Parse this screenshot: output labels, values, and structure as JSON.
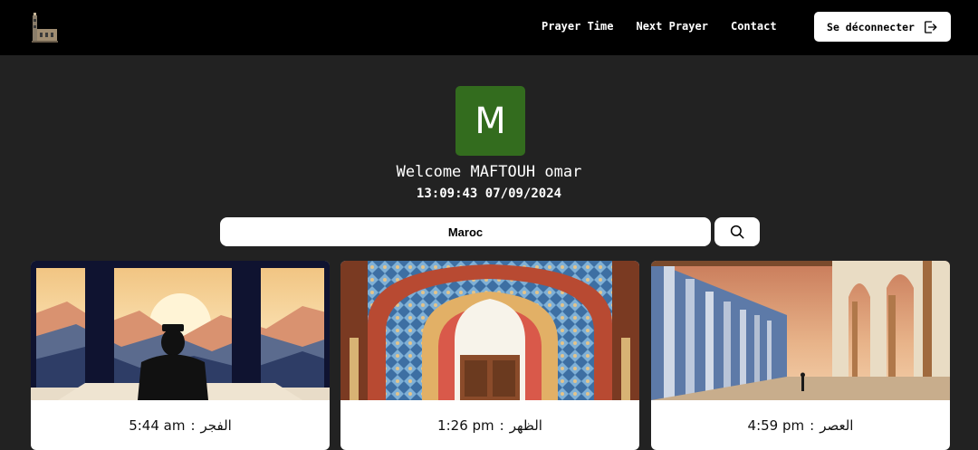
{
  "nav": {
    "logo_icon": "mosque-logo-icon",
    "links": [
      "Prayer Time",
      "Next Prayer",
      "Contact"
    ],
    "logout_label": "Se déconnecter",
    "logout_icon": "logout-icon"
  },
  "profile": {
    "avatar_letter": "M",
    "avatar_color": "#336c1e",
    "welcome": "Welcome MAFTOUH omar",
    "datetime": "13:09:43 07/09/2024"
  },
  "search": {
    "value": "Maroc",
    "icon": "search-icon"
  },
  "prayers": [
    {
      "name": "الفجر",
      "separator": ":",
      "time": "5:44 am"
    },
    {
      "name": "الظهر",
      "separator": ":",
      "time": "1:26 pm"
    },
    {
      "name": "العصر",
      "separator": ":",
      "time": "4:59 pm"
    }
  ]
}
